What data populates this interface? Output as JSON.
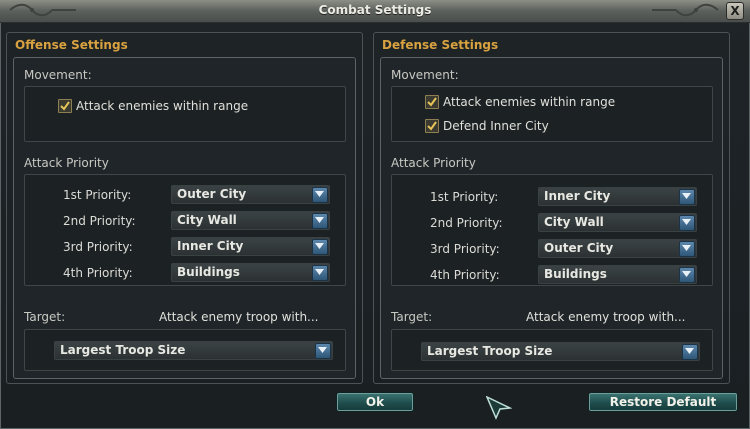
{
  "window": {
    "title": "Combat Settings",
    "close_label": "X"
  },
  "offense": {
    "title": "Offense Settings",
    "movement_label": "Movement:",
    "movement_options": [
      {
        "label": "Attack enemies within range",
        "checked": true
      }
    ],
    "priority_label": "Attack Priority",
    "priorities": [
      {
        "label": "1st Priority:",
        "value": "Outer City"
      },
      {
        "label": "2nd Priority:",
        "value": "City Wall"
      },
      {
        "label": "3rd Priority:",
        "value": "Inner City"
      },
      {
        "label": "4th Priority:",
        "value": "Buildings"
      }
    ],
    "target_label": "Target:",
    "target_hint": "Attack enemy troop with...",
    "target_value": "Largest Troop Size"
  },
  "defense": {
    "title": "Defense Settings",
    "movement_label": "Movement:",
    "movement_options": [
      {
        "label": "Attack enemies within range",
        "checked": true
      },
      {
        "label": "Defend Inner City",
        "checked": true
      }
    ],
    "priority_label": "Attack Priority",
    "priorities": [
      {
        "label": "1st Priority:",
        "value": "Inner City"
      },
      {
        "label": "2nd Priority:",
        "value": "City Wall"
      },
      {
        "label": "3rd Priority:",
        "value": "Outer City"
      },
      {
        "label": "4th Priority:",
        "value": "Buildings"
      }
    ],
    "target_label": "Target:",
    "target_hint": "Attack enemy troop with...",
    "target_value": "Largest Troop Size"
  },
  "buttons": {
    "ok": "Ok",
    "restore": "Restore Default"
  },
  "colors": {
    "section_title": "#d9a240",
    "button": "#2a5f5d",
    "dropdown_arrow": "#4a7ea6"
  }
}
